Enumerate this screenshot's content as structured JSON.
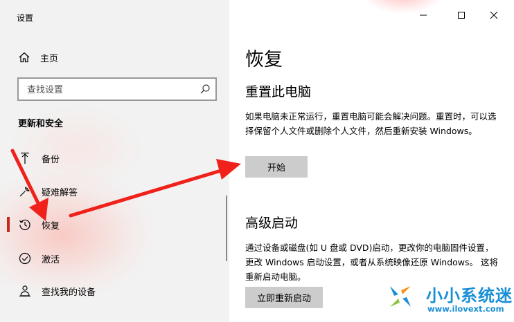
{
  "window": {
    "title": "设置"
  },
  "sidebar": {
    "home_label": "主页",
    "search_placeholder": "查找设置",
    "section_title": "更新和安全",
    "items": [
      {
        "label": "备份",
        "icon": "backup-arrow-icon"
      },
      {
        "label": "疑难解答",
        "icon": "wrench-icon"
      },
      {
        "label": "恢复",
        "icon": "history-icon",
        "selected": true
      },
      {
        "label": "激活",
        "icon": "check-circle-icon"
      },
      {
        "label": "查找我的设备",
        "icon": "person-location-icon"
      }
    ]
  },
  "main": {
    "title": "恢复",
    "reset": {
      "heading": "重置此电脑",
      "description": "如果电脑未正常运行，重置电脑可能会解决问题。重置时，可以选择保留个人文件或删除个人文件，然后重新安装 Windows。",
      "button": "开始"
    },
    "advanced": {
      "heading": "高级启动",
      "description": "通过设备或磁盘(如 U 盘或 DVD)启动，更改你的电脑固件设置，更改 Windows 启动设置，或者从系统映像还原 Windows。 这将重新启动电脑。",
      "button": "立即重新启动"
    }
  },
  "watermark": {
    "text": "小小系统迷",
    "url": "www.ilovext.com"
  },
  "colors": {
    "accent": "#c42b1c",
    "annotation_arrow": "#f0201a",
    "watermark": "#1a8fd6"
  }
}
